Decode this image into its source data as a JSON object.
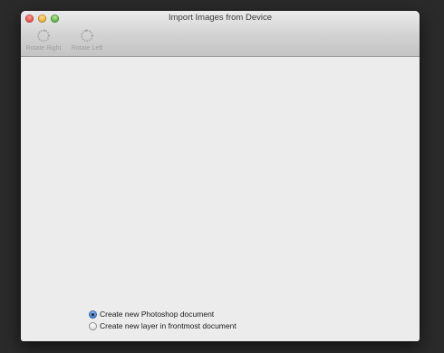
{
  "window": {
    "title": "Import Images from Device"
  },
  "toolbar": {
    "rotate_right": {
      "label": "Rotate Right",
      "icon": "rotate-right-icon"
    },
    "rotate_left": {
      "label": "Rotate Left",
      "icon": "rotate-left-icon"
    }
  },
  "options": [
    {
      "label": "Create new Photoshop document",
      "selected": true
    },
    {
      "label": "Create new layer in frontmost document",
      "selected": false
    }
  ],
  "colors": {
    "accent": "#3c78cf",
    "background": "#ececec"
  }
}
